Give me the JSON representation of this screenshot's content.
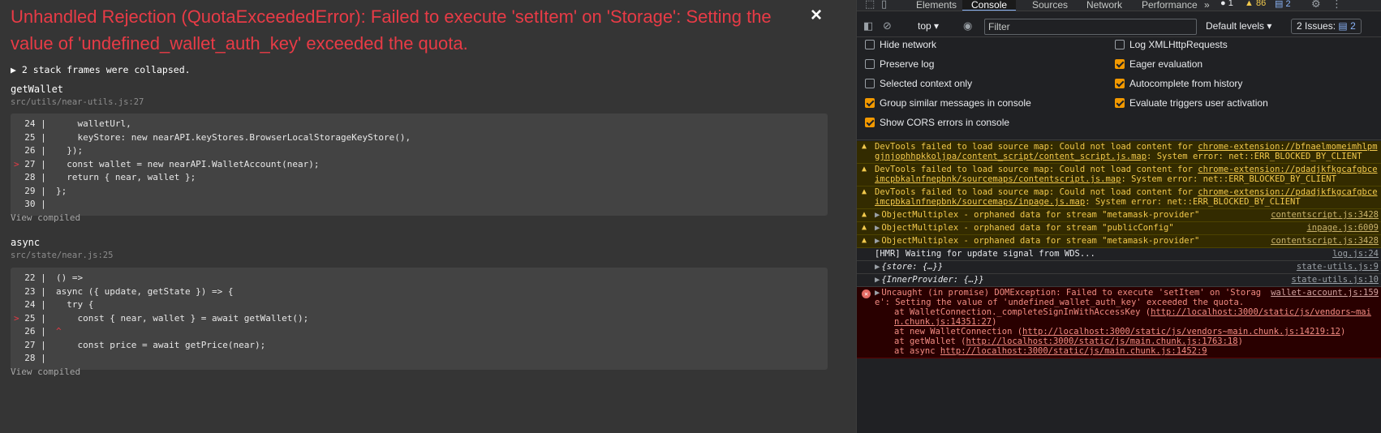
{
  "overlay": {
    "title": "Unhandled Rejection (QuotaExceededError): Failed to execute 'setItem' on 'Storage': Setting the value of 'undefined_wallet_auth_key' exceeded the quota.",
    "close_glyph": "×",
    "collapsed_text": "▶ 2 stack frames were collapsed.",
    "view_compiled": "View compiled",
    "frames": [
      {
        "name": "getWallet",
        "file": "src/utils/near-utils.js:27",
        "lines": [
          {
            "no": "24",
            "marker": "",
            "code": "    walletUrl,"
          },
          {
            "no": "25",
            "marker": "",
            "code": "    keyStore: new nearAPI.keyStores.BrowserLocalStorageKeyStore(),"
          },
          {
            "no": "26",
            "marker": "",
            "code": "  });"
          },
          {
            "no": "27",
            "marker": ">",
            "code": "  const wallet = new nearAPI.WalletAccount(near);"
          },
          {
            "no": "28",
            "marker": "",
            "code": "  return { near, wallet };"
          },
          {
            "no": "29",
            "marker": "",
            "code": "};"
          },
          {
            "no": "30",
            "marker": "",
            "code": ""
          }
        ]
      },
      {
        "name": "async",
        "file": "src/state/near.js:25",
        "lines": [
          {
            "no": "22",
            "marker": "",
            "code": "() =>"
          },
          {
            "no": "23",
            "marker": "",
            "code": "async ({ update, getState }) => {"
          },
          {
            "no": "24",
            "marker": "",
            "code": "  try {"
          },
          {
            "no": "25",
            "marker": ">",
            "code": "    const { near, wallet } = await getWallet();"
          },
          {
            "no": "26",
            "marker": "",
            "code": "^"
          },
          {
            "no": "27",
            "marker": "",
            "code": "    const price = await getPrice(near);"
          },
          {
            "no": "28",
            "marker": "",
            "code": ""
          }
        ]
      }
    ]
  },
  "devtools": {
    "tabs": [
      "Elements",
      "Console",
      "Sources",
      "Network",
      "Performance"
    ],
    "active_tab": "Console",
    "more_tabs": "»",
    "issue_counts": {
      "info": "1",
      "warnings": "86",
      "messages": "2"
    },
    "toolbar": {
      "context": "top",
      "filter_placeholder": "Filter",
      "levels": "Default levels",
      "issues_label": "2 Issues:",
      "issues_count": "2"
    },
    "settings": {
      "left": [
        {
          "label": "Hide network",
          "checked": false
        },
        {
          "label": "Preserve log",
          "checked": false
        },
        {
          "label": "Selected context only",
          "checked": false
        },
        {
          "label": "Group similar messages in console",
          "checked": true
        },
        {
          "label": "Show CORS errors in console",
          "checked": true
        }
      ],
      "right": [
        {
          "label": "Log XMLHttpRequests",
          "checked": false
        },
        {
          "label": "Eager evaluation",
          "checked": true
        },
        {
          "label": "Autocomplete from history",
          "checked": true
        },
        {
          "label": "Evaluate triggers user activation",
          "checked": true
        }
      ]
    },
    "messages": [
      {
        "level": "warn",
        "prefix": "DevTools failed to load source map: Could not load content for ",
        "link": "chrome-extension://bfnaelmomeimhlpmgjnjophhpkkoljpa/content_script/content_script.js.map",
        "suffix": ": System error: net::ERR_BLOCKED_BY_CLIENT"
      },
      {
        "level": "warn",
        "prefix": "DevTools failed to load source map: Could not load content for ",
        "link": "chrome-extension://pdadjkfkgcafgbceimcpbkalnfnepbnk/sourcemaps/contentscript.js.map",
        "suffix": ": System error: net::ERR_BLOCKED_BY_CLIENT"
      },
      {
        "level": "warn",
        "prefix": "DevTools failed to load source map: Could not load content for ",
        "link": "chrome-extension://pdadjkfkgcafgbceimcpbkalnfnepbnk/sourcemaps/inpage.js.map",
        "suffix": ": System error: net::ERR_BLOCKED_BY_CLIENT"
      },
      {
        "level": "warn",
        "text": "ObjectMultiplex - orphaned data for stream \"metamask-provider\"",
        "src": "contentscript.js:3428"
      },
      {
        "level": "warn",
        "text": "ObjectMultiplex - orphaned data for stream \"publicConfig\"",
        "src": "inpage.js:6009"
      },
      {
        "level": "warn",
        "text": "ObjectMultiplex - orphaned data for stream \"metamask-provider\"",
        "src": "contentscript.js:3428"
      },
      {
        "level": "log",
        "text": "[HMR] Waiting for update signal from WDS...",
        "src": "log.js:24"
      },
      {
        "level": "log",
        "text": "{store: {…}}",
        "src": "state-utils.js:9"
      },
      {
        "level": "log",
        "text": "{InnerProvider: {…}}",
        "src": "state-utils.js:10"
      }
    ],
    "error": {
      "head": "Uncaught (in promise) DOMException: Failed to execute 'setItem' on 'Storage': Setting the value of 'undefined_wallet_auth_key' exceeded the quota.",
      "src": "wallet-account.js:159",
      "stack": [
        {
          "prefix": "at WalletConnection._completeSignInWithAccessKey (",
          "link": "http://localhost:3000/static/js/vendors~main.chunk.js:14351:27",
          "suffix": ")"
        },
        {
          "prefix": "at new WalletConnection (",
          "link": "http://localhost:3000/static/js/vendors~main.chunk.js:14219:12",
          "suffix": ")"
        },
        {
          "prefix": "at getWallet (",
          "link": "http://localhost:3000/static/js/main.chunk.js:1763:18",
          "suffix": ")"
        },
        {
          "prefix": "at async ",
          "link": "http://localhost:3000/static/js/main.chunk.js:1452:9",
          "suffix": ""
        }
      ]
    }
  }
}
